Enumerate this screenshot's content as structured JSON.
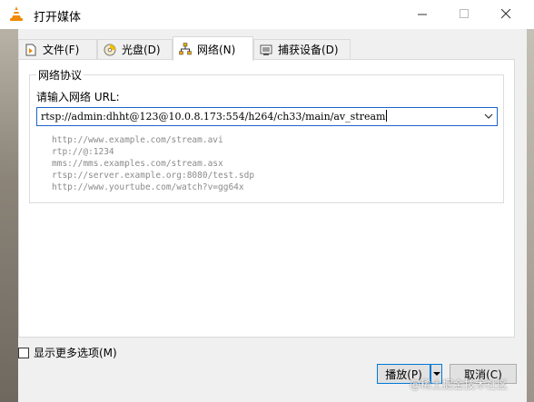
{
  "window": {
    "title": "打开媒体",
    "minimize_icon": "minimize-icon",
    "maximize_icon": "maximize-icon",
    "close_icon": "close-icon"
  },
  "tabs": [
    {
      "label": "文件(F)",
      "icon": "file-icon",
      "active": false
    },
    {
      "label": "光盘(D)",
      "icon": "disc-icon",
      "active": false
    },
    {
      "label": "网络(N)",
      "icon": "network-icon",
      "active": true
    },
    {
      "label": "捕获设备(D)",
      "icon": "capture-device-icon",
      "active": false
    }
  ],
  "network": {
    "group_title": "网络协议",
    "url_label": "请输入网络 URL:",
    "url_value": "rtsp://admin:dhht@123@10.0.8.173:554/h264/ch33/main/av_stream",
    "examples": [
      "http://www.example.com/stream.avi",
      "rtp://@:1234",
      "mms://mms.examples.com/stream.asx",
      "rtsp://server.example.org:8080/test.sdp",
      "http://www.yourtube.com/watch?v=gg64x"
    ]
  },
  "footer": {
    "more_options_label": "显示更多选项(M)",
    "more_options_checked": false,
    "play_label": "播放(P)",
    "cancel_label": "取消(C)"
  },
  "watermark": "@稀土掘金技术社区",
  "colors": {
    "accent": "#0078d7",
    "focus_border": "#1e64c8",
    "example_text": "#8a8a8a"
  }
}
